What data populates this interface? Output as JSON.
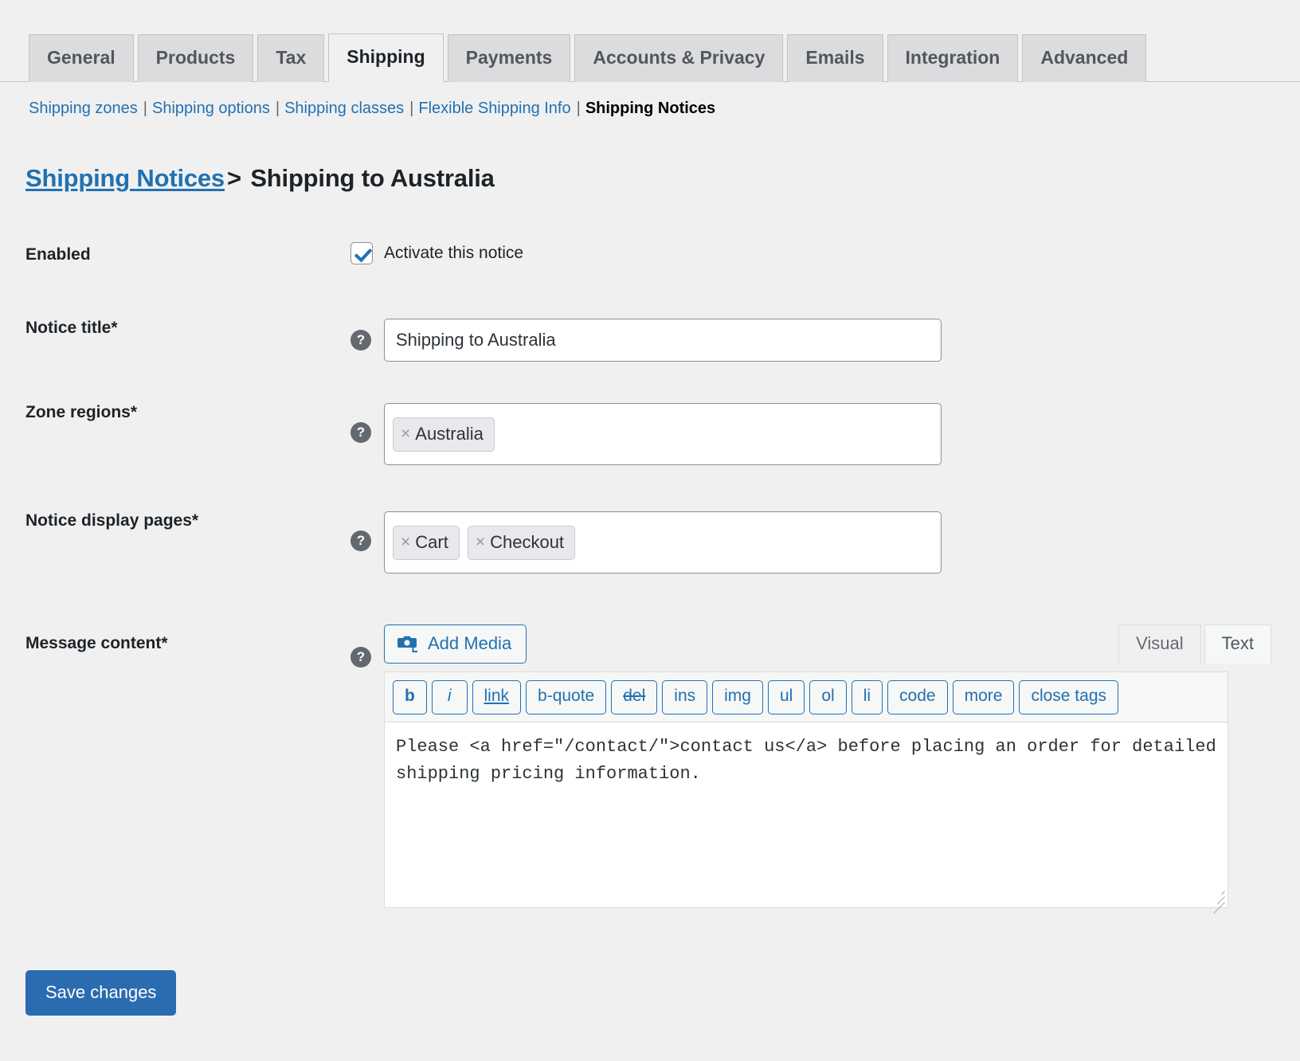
{
  "tabs": [
    {
      "label": "General",
      "active": false
    },
    {
      "label": "Products",
      "active": false
    },
    {
      "label": "Tax",
      "active": false
    },
    {
      "label": "Shipping",
      "active": true
    },
    {
      "label": "Payments",
      "active": false
    },
    {
      "label": "Accounts & Privacy",
      "active": false
    },
    {
      "label": "Emails",
      "active": false
    },
    {
      "label": "Integration",
      "active": false
    },
    {
      "label": "Advanced",
      "active": false
    }
  ],
  "subnav": {
    "separator": "|",
    "items": [
      {
        "label": "Shipping zones",
        "current": false
      },
      {
        "label": "Shipping options",
        "current": false
      },
      {
        "label": "Shipping classes",
        "current": false
      },
      {
        "label": "Flexible Shipping Info",
        "current": false
      },
      {
        "label": "Shipping Notices",
        "current": true
      }
    ]
  },
  "heading": {
    "parent_link": "Shipping Notices",
    "separator": ">",
    "current": "Shipping to Australia"
  },
  "form": {
    "enabled": {
      "label": "Enabled",
      "checkbox_label": "Activate this notice",
      "checked": true
    },
    "notice_title": {
      "label": "Notice title*",
      "help": "?",
      "value": "Shipping to Australia",
      "placeholder": ""
    },
    "zone_regions": {
      "label": "Zone regions*",
      "help": "?",
      "tags": [
        "Australia"
      ],
      "remove_glyph": "×"
    },
    "display_pages": {
      "label": "Notice display pages*",
      "help": "?",
      "tags": [
        "Cart",
        "Checkout"
      ],
      "remove_glyph": "×"
    },
    "message_content": {
      "label": "Message content*",
      "help": "?",
      "add_media_label": "Add Media",
      "editor_tabs": [
        {
          "label": "Visual",
          "active": false
        },
        {
          "label": "Text",
          "active": true
        }
      ],
      "quicktags": [
        {
          "label": "b",
          "style": "bold"
        },
        {
          "label": "i",
          "style": "italic"
        },
        {
          "label": "link",
          "style": "underline"
        },
        {
          "label": "b-quote",
          "style": ""
        },
        {
          "label": "del",
          "style": "strike"
        },
        {
          "label": "ins",
          "style": ""
        },
        {
          "label": "img",
          "style": ""
        },
        {
          "label": "ul",
          "style": ""
        },
        {
          "label": "ol",
          "style": ""
        },
        {
          "label": "li",
          "style": ""
        },
        {
          "label": "code",
          "style": ""
        },
        {
          "label": "more",
          "style": ""
        },
        {
          "label": "close tags",
          "style": ""
        }
      ],
      "content": "Please <a href=\"/contact/\">contact us</a> before placing an order for detailed shipping pricing information."
    }
  },
  "submit": {
    "save_label": "Save changes"
  },
  "colors": {
    "page_bg": "#f0f0f1",
    "link": "#2271b1",
    "primary_button": "#2b6cb0",
    "tab_inactive_bg": "#dcdcde",
    "border": "#c3c4c7",
    "help_bubble": "#646970"
  }
}
